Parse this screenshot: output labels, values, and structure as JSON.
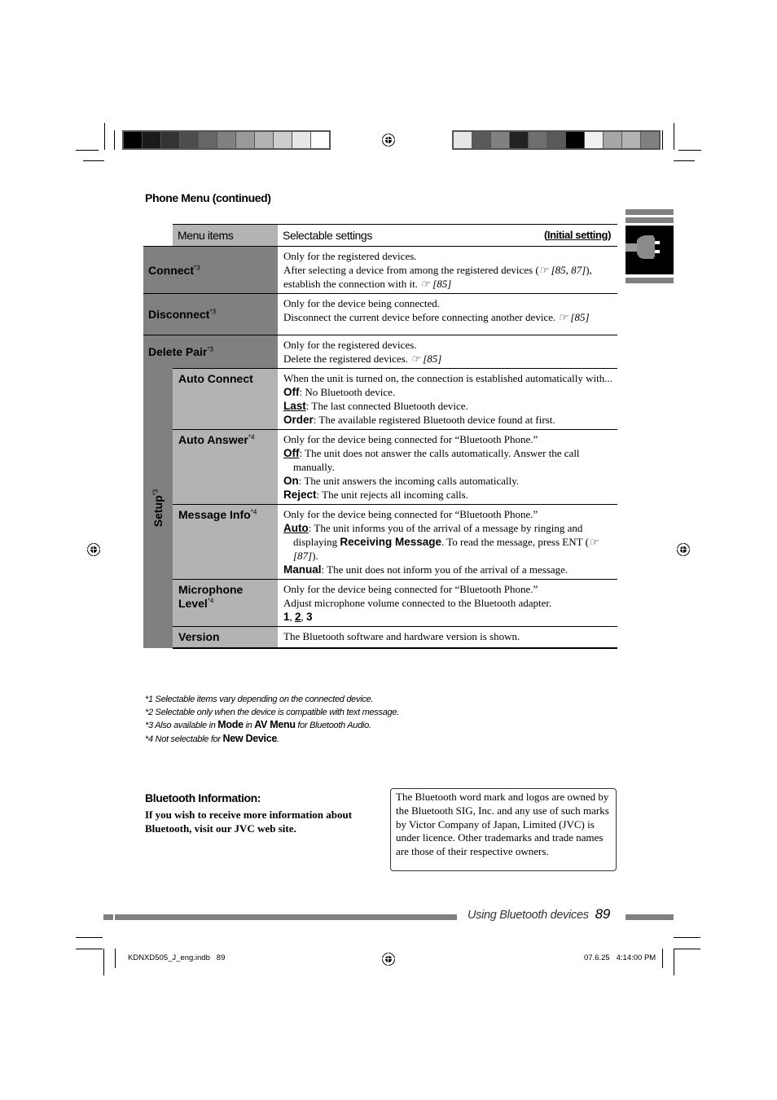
{
  "print_marks": {
    "left_colorbar": [
      "#000000",
      "#1a1a1a",
      "#333333",
      "#4d4d4d",
      "#666666",
      "#808080",
      "#999999",
      "#b3b3b3",
      "#cccccc",
      "#e6e6e6",
      "#ffffff"
    ],
    "right_colorbar": [
      "#e6e6e6",
      "#595959",
      "#808080",
      "#222222",
      "#6e6e6e",
      "#595959",
      "#000000",
      "#f0f0f0",
      "#a6a6a6",
      "#b3b3b3",
      "#808080"
    ]
  },
  "section": {
    "title": "Phone Menu (continued)"
  },
  "table": {
    "header": {
      "menu_items": "Menu items",
      "selectable_settings": "Selectable settings",
      "initial_open": "(",
      "initial_setting": "Initial setting",
      "initial_close": ")"
    },
    "connect": {
      "label": "Connect",
      "sup": "*3",
      "lines": [
        "Only for the registered devices.",
        "After selecting a device from among the registered devices (",
        "☞ [85, 87]",
        "), establish the connection with it. ",
        "☞ [85]"
      ]
    },
    "disconnect": {
      "label": "Disconnect",
      "sup": "*3",
      "line1": "Only for the device being connected.",
      "line2": "Disconnect the current device before connecting another device. ",
      "ref": "☞ [85]"
    },
    "delete_pair": {
      "label": "Delete Pair",
      "sup": "*3",
      "line1": "Only for the registered devices.",
      "line2": "Delete the registered devices. ",
      "ref": "☞ [85]"
    },
    "setup": {
      "label": "Setup",
      "sup": "*3",
      "auto_connect": {
        "label": "Auto Connect",
        "intro": "When the unit is turned on, the connection is established automatically with...",
        "options": [
          {
            "key": "Off",
            "initial": false,
            "text": ": No Bluetooth device."
          },
          {
            "key": "Last",
            "initial": true,
            "text": ": The last connected Bluetooth device."
          },
          {
            "key": "Order",
            "initial": false,
            "text": ": The available registered Bluetooth device found at first."
          }
        ]
      },
      "auto_answer": {
        "label": "Auto Answer",
        "sup": "*4",
        "intro": "Only for the device being connected for “Bluetooth Phone.”",
        "options": [
          {
            "key": "Off",
            "initial": true,
            "text": ": The unit does not answer the calls automatically. Answer the call manually."
          },
          {
            "key": "On",
            "initial": false,
            "text": ": The unit answers the incoming calls automatically."
          },
          {
            "key": "Reject",
            "initial": false,
            "text": ": The unit rejects all incoming calls."
          }
        ]
      },
      "message_info": {
        "label": "Message Info",
        "sup": "*4",
        "intro": "Only for the device being connected for “Bluetooth Phone.”",
        "auto_key": "Auto",
        "auto_text1": ": The unit informs you of the arrival of a message by ringing and displaying ",
        "auto_kw": "Receiving Message",
        "auto_text2": ". To read the message, press ENT (",
        "auto_ref": "☞ [87]",
        "auto_text3": ").",
        "manual_key": "Manual",
        "manual_text": ": The unit does not inform you of the arrival of a message."
      },
      "microphone_level": {
        "label_line1": "Microphone",
        "label_line2": "Level",
        "sup": "*4",
        "intro": "Only for the device being connected for “Bluetooth Phone.”",
        "line2": "Adjust microphone volume connected to the Bluetooth adapter.",
        "levels": [
          "1",
          "2",
          "3"
        ],
        "initial_level": "2"
      },
      "version": {
        "label": "Version",
        "text": "The Bluetooth software and hardware version is shown."
      }
    }
  },
  "footnotes": {
    "n1": "*1 Selectable items vary depending on the connected device.",
    "n2": "*2 Selectable only when the device is compatible with text message.",
    "n3_a": "*3 Also available in ",
    "n3_kw1": "Mode",
    "n3_b": " in ",
    "n3_kw2": "AV Menu",
    "n3_c": " for Bluetooth Audio.",
    "n4_a": "*4 Not selectable for ",
    "n4_kw": "New Device",
    "n4_b": "."
  },
  "bluetooth_info": {
    "title": "Bluetooth Information:",
    "body": "If you wish to receive more information about Bluetooth, visit our JVC web site.",
    "trademark": "The Bluetooth word mark and logos are owned by the Bluetooth SIG, Inc. and any use of such marks by Victor Company of Japan, Limited (JVC) is under licence. Other trademarks and trade names are those of their respective owners."
  },
  "footer": {
    "section_label": "Using Bluetooth devices",
    "page_number": "89",
    "slug_file": "KDNXD505_J_eng.indb   89",
    "slug_timestamp": "07.6.25   4:14:00 PM"
  },
  "sidebar_tab": {
    "icon": "bluetooth-adapter-plug-icon"
  }
}
